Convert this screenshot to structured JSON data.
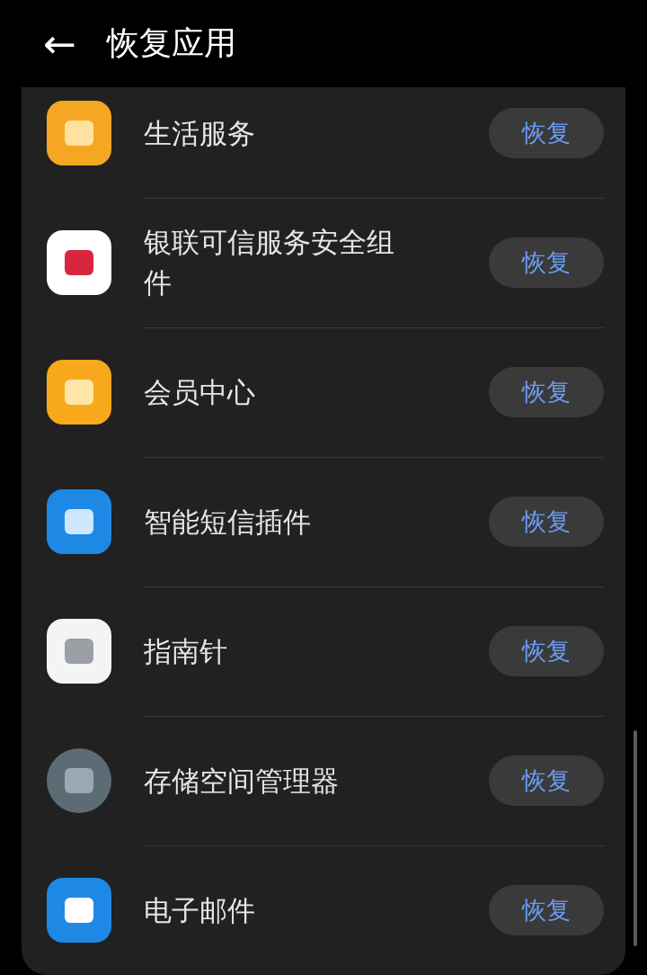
{
  "header": {
    "back": "←",
    "title": "恢复应用"
  },
  "apps": [
    {
      "name": "生活服务",
      "button": "恢复"
    },
    {
      "name": "银联可信服务安全组件",
      "button": "恢复"
    },
    {
      "name": "会员中心",
      "button": "恢复"
    },
    {
      "name": "智能短信插件",
      "button": "恢复"
    },
    {
      "name": "指南针",
      "button": "恢复"
    },
    {
      "name": "存储空间管理器",
      "button": "恢复"
    },
    {
      "name": "电子邮件",
      "button": "恢复"
    }
  ]
}
